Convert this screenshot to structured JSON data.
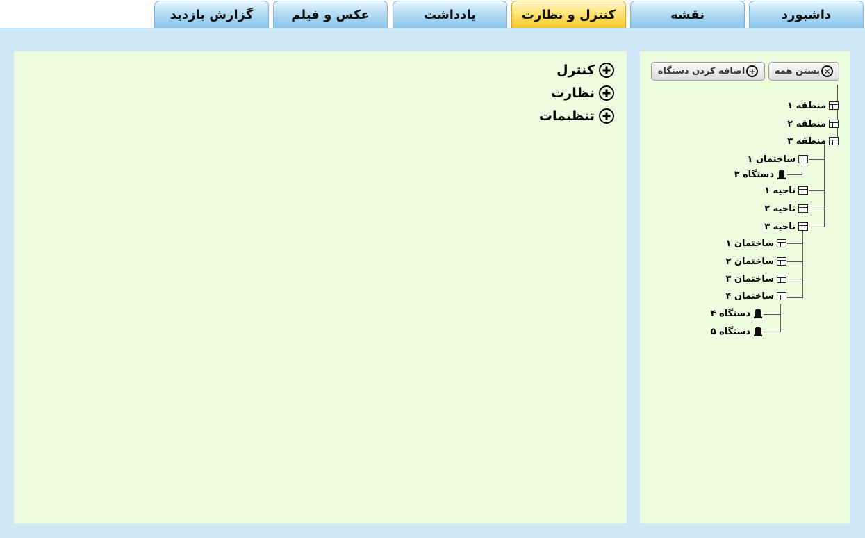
{
  "tabs": [
    {
      "label": "داشبورد",
      "active": false
    },
    {
      "label": "نقشه",
      "active": false
    },
    {
      "label": "کنترل و نظارت",
      "active": true
    },
    {
      "label": "یادداشت",
      "active": false
    },
    {
      "label": "عکس و فیلم",
      "active": false
    },
    {
      "label": "گزارش بازدید",
      "active": false
    }
  ],
  "main": {
    "sections": [
      {
        "label": "کنترل"
      },
      {
        "label": "نظارت"
      },
      {
        "label": "تنظیمات"
      }
    ]
  },
  "tree_panel": {
    "close_all_label": "بستن همه",
    "add_device_label": "اضافه کردن دستگاه",
    "nodes": [
      {
        "label": "منطقه ۱",
        "icon": "folder-icon"
      },
      {
        "label": "منطقه ۲",
        "icon": "folder-icon"
      },
      {
        "label": "منطقه ۳",
        "icon": "folder-icon"
      },
      {
        "label": "ساختمان ۱",
        "icon": "folder-icon"
      },
      {
        "label": "دستگاه ۳",
        "icon": "device-icon"
      },
      {
        "label": "ناحیه ۱",
        "icon": "folder-icon"
      },
      {
        "label": "ناحیه ۲",
        "icon": "folder-icon"
      },
      {
        "label": "ناحیه ۳",
        "icon": "folder-icon"
      },
      {
        "label": "ساختمان ۱",
        "icon": "folder-icon"
      },
      {
        "label": "ساختمان ۲",
        "icon": "folder-icon"
      },
      {
        "label": "ساختمان ۳",
        "icon": "folder-icon"
      },
      {
        "label": "ساختمان ۴",
        "icon": "folder-icon"
      },
      {
        "label": "دستگاه ۴",
        "icon": "device-icon"
      },
      {
        "label": "دستگاه ۵",
        "icon": "device-icon"
      }
    ]
  },
  "colors": {
    "tab_blue": "#8cc6ea",
    "tab_active": "#f8c62a",
    "frame": "#cfe8f6",
    "panel": "#edfbdf"
  }
}
